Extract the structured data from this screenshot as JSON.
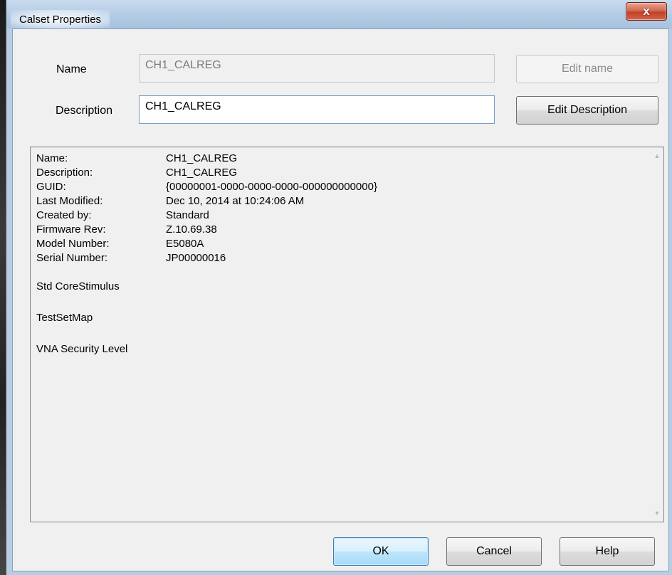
{
  "window": {
    "title": "Calset Properties",
    "close_glyph": "x"
  },
  "form": {
    "name_label": "Name",
    "name_value": "CH1_CALREG",
    "description_label": "Description",
    "description_value": "CH1_CALREG",
    "edit_name_label": "Edit name",
    "edit_description_label": "Edit Description"
  },
  "details": {
    "rows": [
      {
        "key": "Name:",
        "value": "CH1_CALREG"
      },
      {
        "key": "Description:",
        "value": "CH1_CALREG"
      },
      {
        "key": "GUID:",
        "value": "{00000001-0000-0000-0000-000000000000}"
      },
      {
        "key": "Last Modified:",
        "value": "Dec 10, 2014 at 10:24:06 AM"
      },
      {
        "key": "Created by:",
        "value": "Standard"
      },
      {
        "key": "Firmware Rev:",
        "value": "Z.10.69.38"
      },
      {
        "key": "Model Number:",
        "value": "E5080A"
      },
      {
        "key": "Serial Number:",
        "value": "JP00000016"
      }
    ],
    "sections": [
      "Std CoreStimulus",
      "TestSetMap",
      "VNA Security Level"
    ]
  },
  "buttons": {
    "ok": "OK",
    "cancel": "Cancel",
    "help": "Help"
  },
  "icons": {
    "scroll_up": "chevron-up-icon",
    "scroll_down": "chevron-down-icon",
    "close": "close-icon"
  },
  "colors": {
    "title_bar": "#b3cbe4",
    "close_button": "#c04128",
    "default_button": "#bee6fd"
  }
}
